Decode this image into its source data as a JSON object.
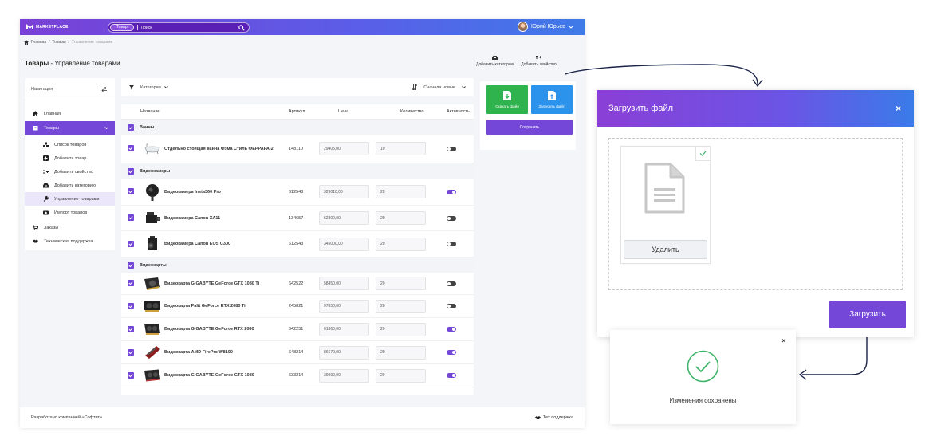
{
  "brand": {
    "logo_text": "MARKETPLACE"
  },
  "search": {
    "chip": "Товар",
    "placeholder": "Поиск"
  },
  "user": {
    "name": "Юрий Юрьев"
  },
  "breadcrumb": {
    "home": "Главная",
    "sep": "/",
    "goods": "Товары",
    "current": "Управление товарами"
  },
  "page": {
    "title_bold": "Товары",
    "title_rest": " - Управление товарами"
  },
  "top_actions": {
    "add_category": "Добавить категорию",
    "add_property": "Добавить свойство"
  },
  "sidebar": {
    "header": "Навигация",
    "home": "Главная",
    "goods": "Товары",
    "sub": [
      "Список товаров",
      "Добавить товар",
      "Добавить свойство",
      "Добавить категорию",
      "Управление товарами",
      "Импорт товаров"
    ],
    "orders": "Заказы",
    "support": "Техническая поддержка"
  },
  "filter": {
    "category": "Категория",
    "sort": "Сначала новые"
  },
  "table": {
    "headers": {
      "name": "Название",
      "article": "Артикул",
      "price": "Цена",
      "qty": "Количество",
      "active": "Активность"
    },
    "groups": [
      "Ванны",
      "Видеокамеры",
      "Видеокарты"
    ],
    "rows": [
      {
        "name": "Отдельно стоящая ванна Фэма Стиль ФЕРРАРА-2",
        "article": "148110",
        "price": "29405,00",
        "qty": "10",
        "active": false
      },
      {
        "name": "Видеокамера Insta360 Pro",
        "article": "612548",
        "price": "329010,00",
        "qty": "20",
        "active": true
      },
      {
        "name": "Видеокамера Canon XA11",
        "article": "134657",
        "price": "62800,00",
        "qty": "20",
        "active": false
      },
      {
        "name": "Видеокамера Canon EOS C300",
        "article": "612543",
        "price": "345000,00",
        "qty": "20",
        "active": false
      },
      {
        "name": "Видеокарта GIGABYTE GeForce GTX 1080 Ti",
        "article": "642522",
        "price": "58450,00",
        "qty": "20",
        "active": false
      },
      {
        "name": "Видеокарта Palit GeForce RTX 2080 Ti",
        "article": "245821",
        "price": "97850,00",
        "qty": "20",
        "active": false
      },
      {
        "name": "Видеокарта GIGABYTE GeForce RTX 2080",
        "article": "642251",
        "price": "61360,00",
        "qty": "20",
        "active": true
      },
      {
        "name": "Видеокарта AMD FirePro W8100",
        "article": "648214",
        "price": "86679,00",
        "qty": "20",
        "active": true
      },
      {
        "name": "Видеокарта GIGABYTE GeForce GTX 1080",
        "article": "633214",
        "price": "39990,00",
        "qty": "20",
        "active": true
      }
    ]
  },
  "actions": {
    "download": "Скачать файл",
    "upload": "Загрузить файл",
    "save": "Сохранить"
  },
  "footer": {
    "left": "Разработано компанией «Софтит»",
    "right": "Тех поддержка"
  },
  "modal": {
    "title": "Загрузить файл",
    "delete": "Удалить",
    "submit": "Загрузить"
  },
  "toast": {
    "message": "Изменения сохранены"
  },
  "colors": {
    "accent": "#7447d9",
    "green": "#2eb34e",
    "blue": "#2b93ec",
    "success": "#3fb56b"
  }
}
